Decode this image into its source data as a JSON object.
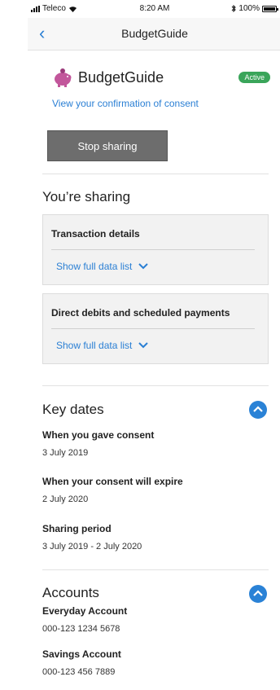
{
  "status_bar": {
    "carrier": "Teleco",
    "time": "8:20 AM",
    "battery": "100%"
  },
  "nav": {
    "back": "‹",
    "title": "BudgetGuide"
  },
  "app": {
    "name": "BudgetGuide",
    "status": "Active",
    "consent_link": "View your confirmation of consent"
  },
  "stop_button": "Stop sharing",
  "sharing": {
    "heading": "You’re sharing",
    "items": [
      {
        "title": "Transaction details",
        "link": "Show full data list"
      },
      {
        "title": "Direct debits and scheduled payments",
        "link": "Show full data list"
      }
    ]
  },
  "key_dates": {
    "heading": "Key dates",
    "rows": [
      {
        "label": "When you gave consent",
        "value": "3 July 2019"
      },
      {
        "label": "When your consent will expire",
        "value": "2 July 2020"
      },
      {
        "label": "Sharing period",
        "value": "3 July 2019 - 2 July 2020"
      }
    ]
  },
  "accounts": {
    "heading": "Accounts",
    "rows": [
      {
        "label": "Everyday Account",
        "value": "000-123 1234 5678"
      },
      {
        "label": "Savings Account",
        "value": "000-123 456 7889"
      }
    ]
  },
  "colors": {
    "link": "#2a7fd4",
    "active_badge": "#3aa55a",
    "stop_button": "#6d6d6d",
    "accordion_circle": "#2a82d6",
    "logo": "#c2569b"
  }
}
